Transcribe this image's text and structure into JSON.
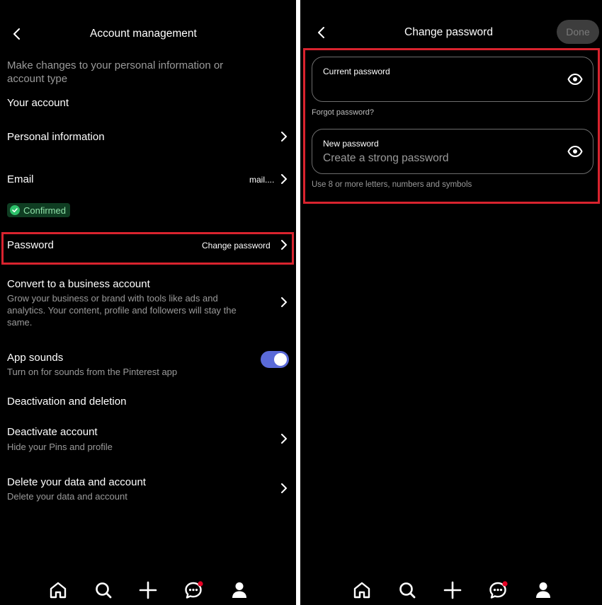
{
  "left": {
    "header": {
      "title": "Account management"
    },
    "intro": "Make changes to your personal information or account type",
    "section_your_account": "Your account",
    "personal_info": {
      "label": "Personal information"
    },
    "email": {
      "label": "Email",
      "value": "mail....",
      "badge": "Confirmed"
    },
    "password": {
      "label": "Password",
      "value": "Change password"
    },
    "business": {
      "label": "Convert to a business account",
      "desc_line1": "Grow your business or brand with tools like ads and",
      "desc_line2": "analytics. Your content, profile and followers will stay the",
      "desc_line3": "same."
    },
    "app_sounds": {
      "label": "App sounds",
      "desc": "Turn on for sounds from the Pinterest app",
      "enabled": true
    },
    "section_deactivation": "Deactivation and deletion",
    "deactivate": {
      "label": "Deactivate account",
      "desc": "Hide your Pins and profile"
    },
    "delete": {
      "label": "Delete your data and account",
      "desc": "Delete your data and account"
    }
  },
  "right": {
    "header": {
      "title": "Change password",
      "done_label": "Done"
    },
    "current_password": {
      "label": "Current password",
      "value": "",
      "placeholder": ""
    },
    "forgot_link": "Forgot password?",
    "new_password": {
      "label": "New password",
      "value": "",
      "placeholder": "Create a strong password"
    },
    "hint": "Use 8 or more letters, numbers and symbols"
  },
  "bottom_nav": {
    "items": [
      {
        "icon": "home-icon"
      },
      {
        "icon": "search-icon"
      },
      {
        "icon": "plus-icon"
      },
      {
        "icon": "messages-icon",
        "has_notification": true
      },
      {
        "icon": "profile-icon"
      }
    ]
  },
  "colors": {
    "background": "#000000",
    "highlight": "#d9232e",
    "toggle_on": "#5a6ad8",
    "confirmed_badge": "#0f3d22",
    "notification_dot": "#e60023"
  }
}
